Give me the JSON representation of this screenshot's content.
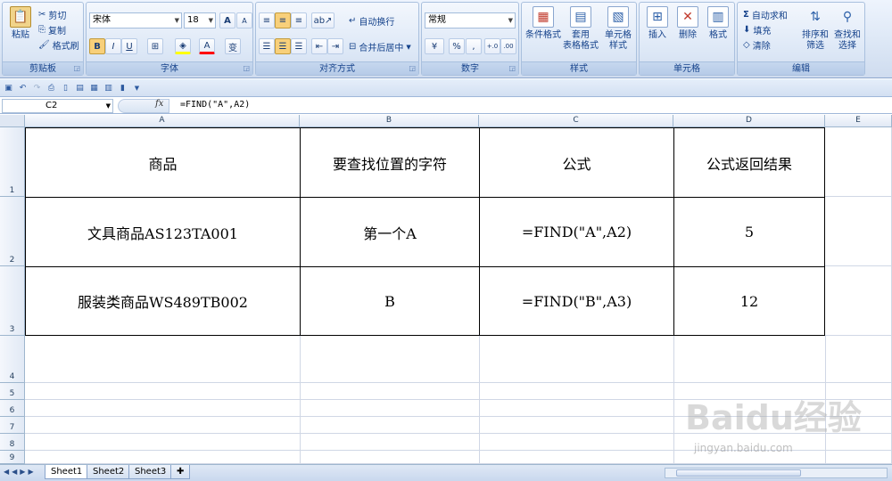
{
  "ribbon": {
    "clipboard": {
      "label": "剪贴板",
      "paste": "粘贴",
      "cut": "剪切",
      "copy": "复制",
      "format_painter": "格式刷"
    },
    "font": {
      "label": "字体",
      "name": "宋体",
      "size": "18",
      "bold": "B",
      "italic": "I",
      "underline": "U",
      "grow": "A",
      "shrink": "A",
      "font_color": "A",
      "phonetic": "变"
    },
    "alignment": {
      "label": "对齐方式",
      "wrap": "自动换行",
      "merge": "合并后居中"
    },
    "number": {
      "label": "数字",
      "format": "常规",
      "percent": "%",
      "comma": ",",
      "inc_decimal": "+.0",
      "dec_decimal": ".00"
    },
    "styles": {
      "label": "样式",
      "conditional": "条件格式",
      "table_format_line1": "套用",
      "table_format_line2": "表格格式",
      "cell_styles_line1": "单元格",
      "cell_styles_line2": "样式"
    },
    "cells": {
      "label": "单元格",
      "insert": "插入",
      "delete": "删除",
      "format": "格式"
    },
    "editing": {
      "label": "编辑",
      "autosum": "自动求和",
      "fill": "填充",
      "clear": "清除",
      "sort_line1": "排序和",
      "sort_line2": "筛选",
      "find_line1": "查找和",
      "find_line2": "选择"
    }
  },
  "formula_bar": {
    "name_box": "C2",
    "fx": "fx",
    "formula": "=FIND(\"A\",A2)"
  },
  "columns": [
    "A",
    "B",
    "C",
    "D",
    "E"
  ],
  "rows": [
    "1",
    "2",
    "3",
    "4",
    "5",
    "6",
    "7",
    "8",
    "9"
  ],
  "table": {
    "headers": [
      "商品",
      "要查找位置的字符",
      "公式",
      "公式返回结果"
    ],
    "rows": [
      [
        "文具商品AS123TA001",
        "第一个A",
        "=FIND(\"A\",A2)",
        "5"
      ],
      [
        "服装类商品WS489TB002",
        "B",
        "=FIND(\"B\",A3)",
        "12"
      ]
    ]
  },
  "sheets": [
    "Sheet1",
    "Sheet2",
    "Sheet3"
  ],
  "watermark": {
    "main": "Baidu经验",
    "sub": "jingyan.baidu.com"
  }
}
